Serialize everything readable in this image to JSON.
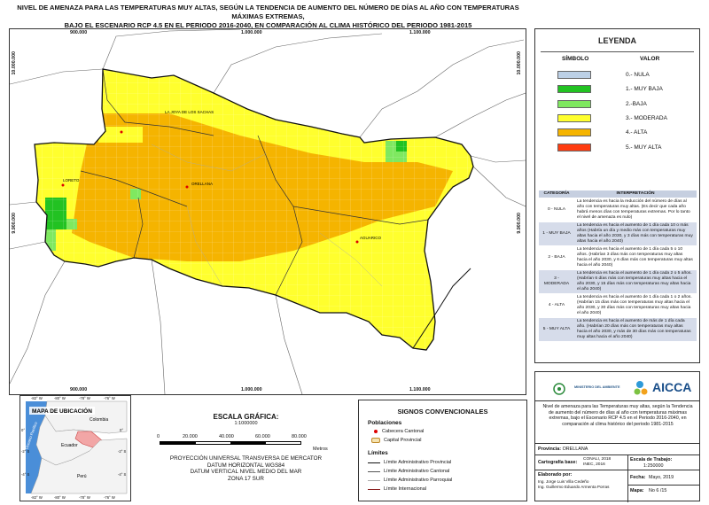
{
  "title": {
    "line1": "NIVEL DE AMENAZA PARA LAS TEMPERATURAS MUY ALTAS, SEGÚN LA TENDENCIA DE AUMENTO DEL NÚMERO DE DÍAS AL AÑO CON TEMPERATURAS MÁXIMAS EXTREMAS,",
    "line2": "BAJO EL ESCENARIO RCP 4.5 EN EL PERIODO 2016-2040, EN COMPARACIÓN AL CLIMA HISTÓRICO DEL PERIODO 1981-2015"
  },
  "map": {
    "x_ticks": [
      "900.000",
      "1.000.000",
      "1.100.000"
    ],
    "y_ticks": [
      "10.000.000",
      "9.900.000"
    ],
    "places": {
      "aguarico": "AGUARICO",
      "loreto": "LORETO",
      "orellana": "ORELLANA",
      "sachas": "LA JOYA DE LOS SACHAS"
    }
  },
  "legend": {
    "title": "LEYENDA",
    "col_symbol": "SÍMBOLO",
    "col_value": "VALOR",
    "items": [
      {
        "label": "0.- NULA",
        "color": "#bcd0e6"
      },
      {
        "label": "1.- MUY BAJA",
        "color": "#22c222"
      },
      {
        "label": "2.-BAJA",
        "color": "#7fe860"
      },
      {
        "label": "3.- MODERADA",
        "color": "#ffff2e"
      },
      {
        "label": "4.- ALTA",
        "color": "#f5b400"
      },
      {
        "label": "5.- MUY ALTA",
        "color": "#ff3c10"
      }
    ]
  },
  "interpretation": {
    "head_cat": "CATEGORÍA",
    "head_interp": "INTERPRETACIÓN",
    "rows": [
      {
        "cat": "0 - NULA",
        "text": "La tendencia es hacia la reducción del número de días al año con temperaturas muy altas. (Es decir que cada año habrá menos días con temperaturas extremas. Por lo tanto el nivel de amenaza es nulo)"
      },
      {
        "cat": "1 - MUY BAJA",
        "text": "La tendencia es hacia el aumento de 1 día cada 10 o más años (Habría un día y medio más con temperaturas muy altas hacia el año 2030, y 3 días más con temperaturas muy altas hacia el año 2040)"
      },
      {
        "cat": "2 - BAJA",
        "text": "La tendencia es hacia el aumento de 1 día cada 5 o 10 años. (Habrían 3 días más con temperaturas muy altas hacia el año 2030, y 6 días más con temperaturas muy altas hacia el año 2040)"
      },
      {
        "cat": "3 - MODERADA",
        "text": "La tendencia es hacia el aumento de 1 día cada 2 o 5 años. (Habrían 6 días más con temperaturas muy altas hacia el año 2030, y 15 días más con temperaturas muy altas hacia el año 2040)"
      },
      {
        "cat": "4 - ALTA",
        "text": "La tendencia es hacia el aumento de 1 día cada 1 o 2 años. (Habrían 15 días más con temperaturas muy altas hacia el año 2030, y 30 días más con temperaturas muy altas hacia el año 2040)"
      },
      {
        "cat": "5 - MUY ALTA",
        "text": "La tendencia es hacia el aumento de más de 1 día cada año. (Habrían 20 días más con temperaturas muy altas hacia el año 2030, y más de 30 días más con temperaturas muy altas hacia el año 2040)"
      }
    ]
  },
  "location_map": {
    "title": "MAPA DE UBICACIÓN",
    "top_ticks": [
      "-82° W",
      "-80° W",
      "-78° W",
      "-76° W"
    ],
    "bottom_ticks": [
      "-82° W",
      "-80° W",
      "-78° W",
      "-76° W"
    ],
    "left_ticks": [
      "0°",
      "-2° S",
      "-4° S"
    ],
    "right_ticks": [
      "0°",
      "-2° S",
      "-4° S"
    ],
    "ocean": "Oceano Pacifico",
    "countries": {
      "colombia": "Colombia",
      "ecuador": "Ecuador",
      "peru": "Perú"
    }
  },
  "scale": {
    "title": "ESCALA GRÁFICA:",
    "ratio": "1:1000000",
    "ticks": [
      "0",
      "20.000",
      "40.000",
      "60.000",
      "80.000"
    ],
    "unit": "Metros",
    "projection": [
      "PROYECCIÓN UNIVERSAL TRANSVERSA DE MERCATOR",
      "DATUM HORIZONTAL WGS84",
      "DATUM VERTICAL NIVEL MEDIO DEL MAR",
      "ZONA 17 SUR"
    ]
  },
  "signs": {
    "title": "SIGNOS CONVENCIONALES",
    "populations_title": "Poblaciones",
    "cabecera": "Cabecera Cantonal",
    "capital": "Capital Provincial",
    "limits_title": "Límites",
    "limits": [
      "Límite Administrativo Provincial",
      "Límite Administrativo Cantonal",
      "Límite Administrativo Parroquial",
      "Límite Internacional"
    ]
  },
  "info": {
    "ministry": "MINISTERIO DEL AMBIENTE",
    "logo": "AICCA",
    "description": "Nivel de amenaza para las Temperaturas muy altas, según la Tendencia de aumento del número de días al año con temperaturas máximas extremas, bajo el Escenario RCP 4.5 en el Periodo 2016-2040, en comparación al clima histórico del periodo 1981-2015",
    "provincia_label": "Provincia:",
    "provincia": "ORELLANA",
    "base_label": "Cartografía base:",
    "base_value": "CONALI, 2018\nINEC, 2016",
    "scale_label": "Escala de Trabajo:",
    "scale_value": "1:250000",
    "elab_label": "Elaborado por:",
    "elab_1": "Ing. Jorge Luis Villa Cedeño",
    "elab_2": "Ing. Guillermo Eduardo Armenta Porras",
    "fecha_label": "Fecha:",
    "fecha": "Mayo, 2019",
    "mapa_label": "Mapa:",
    "mapa": "No 6 /15"
  }
}
